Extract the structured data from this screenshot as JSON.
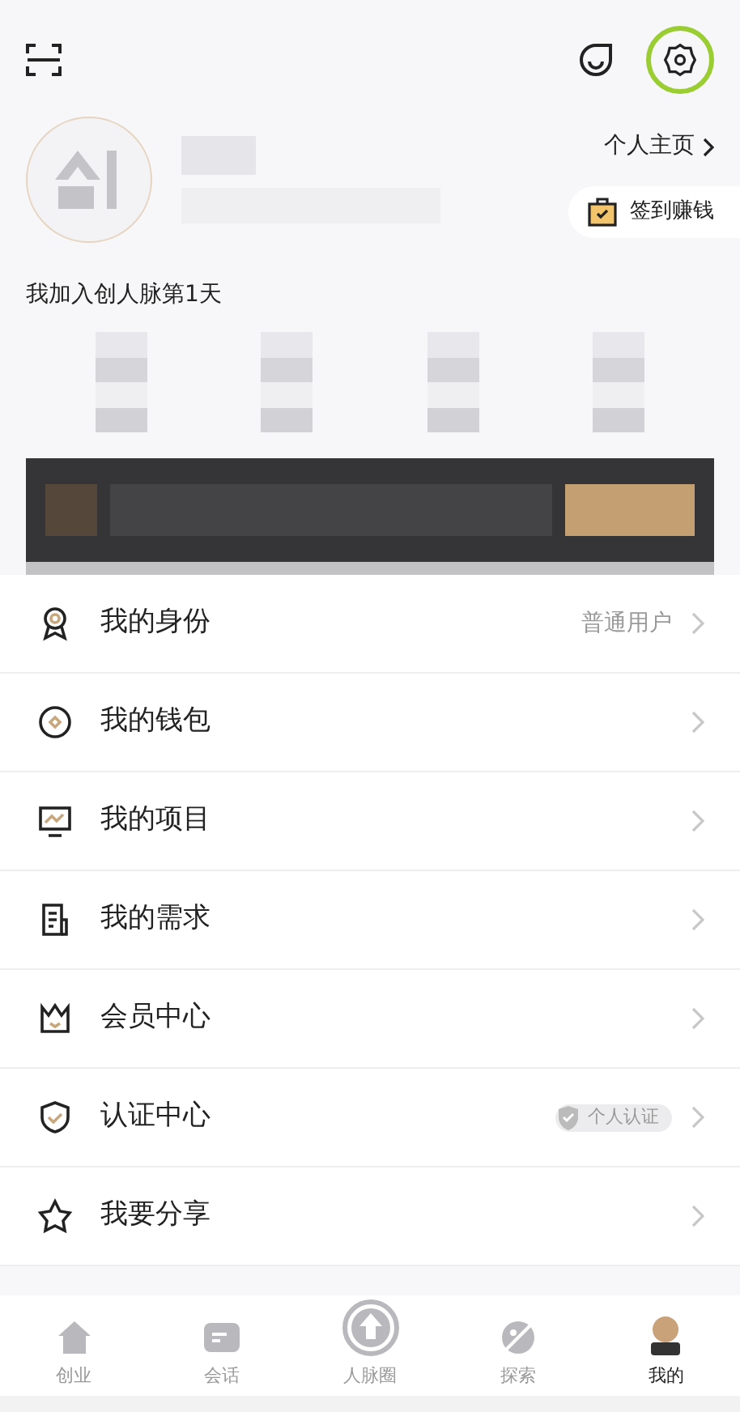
{
  "header": {
    "profile_link": "个人主页",
    "checkin_button": "签到赚钱",
    "joined_text": "我加入创人脉第1天"
  },
  "menu": [
    {
      "kind": "badge",
      "label": "我的身份",
      "value": "普通用户"
    },
    {
      "kind": "wallet",
      "label": "我的钱包"
    },
    {
      "kind": "project",
      "label": "我的项目"
    },
    {
      "kind": "demand",
      "label": "我的需求"
    },
    {
      "kind": "member",
      "label": "会员中心"
    },
    {
      "kind": "verify",
      "label": "认证中心",
      "tag": "个人认证"
    },
    {
      "kind": "share",
      "label": "我要分享"
    }
  ],
  "tabs": [
    {
      "kind": "home",
      "label": "创业",
      "selected": false
    },
    {
      "kind": "chat",
      "label": "会话",
      "selected": false
    },
    {
      "kind": "circle",
      "label": "人脉圈",
      "selected": false
    },
    {
      "kind": "explore",
      "label": "探索",
      "selected": false
    },
    {
      "kind": "me",
      "label": "我的",
      "selected": true
    }
  ]
}
